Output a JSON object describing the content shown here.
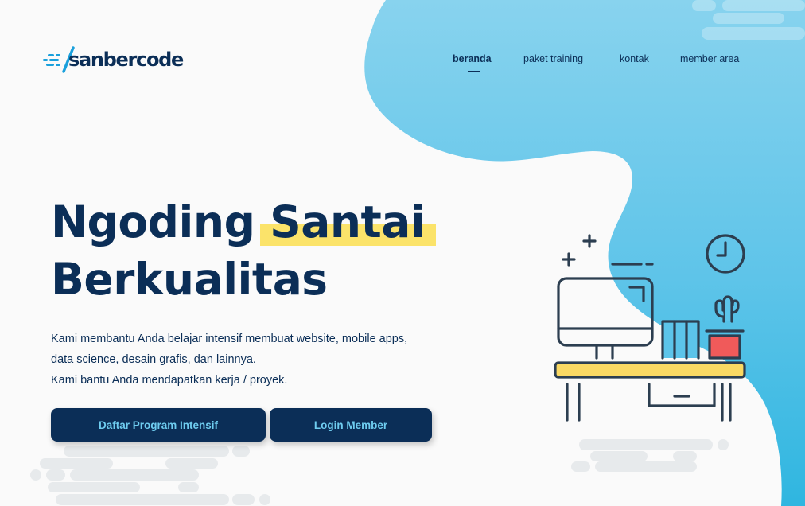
{
  "brand": {
    "name": "sanbercode"
  },
  "nav": {
    "items": [
      {
        "label": "beranda",
        "active": true
      },
      {
        "label": "paket training",
        "active": false
      },
      {
        "label": "kontak",
        "active": false
      },
      {
        "label": "member area",
        "active": false
      }
    ]
  },
  "hero": {
    "title_part1": "Ngoding",
    "title_highlight": "Santai",
    "title_line2": "Berkualitas",
    "desc_line1": "Kami membantu Anda belajar intensif membuat website, mobile apps,",
    "desc_line2": "data science, desain grafis, dan lainnya.",
    "desc_line3": "Kami bantu Anda mendapatkan kerja / proyek.",
    "cta_primary": "Daftar Program Intensif",
    "cta_secondary": "Login Member"
  },
  "colors": {
    "navy": "#0b2e57",
    "accent_blue": "#6fcdf0",
    "highlight_yellow": "#fbe36a",
    "blob_blue": "#5cc4ea",
    "pot_red": "#f05a5a",
    "plant_green": "#5cc4ea"
  },
  "icons": [
    "logo-mark-icon",
    "clock-icon",
    "plus-icon",
    "monitor-icon",
    "cactus-icon",
    "books-icon",
    "desk-icon"
  ]
}
